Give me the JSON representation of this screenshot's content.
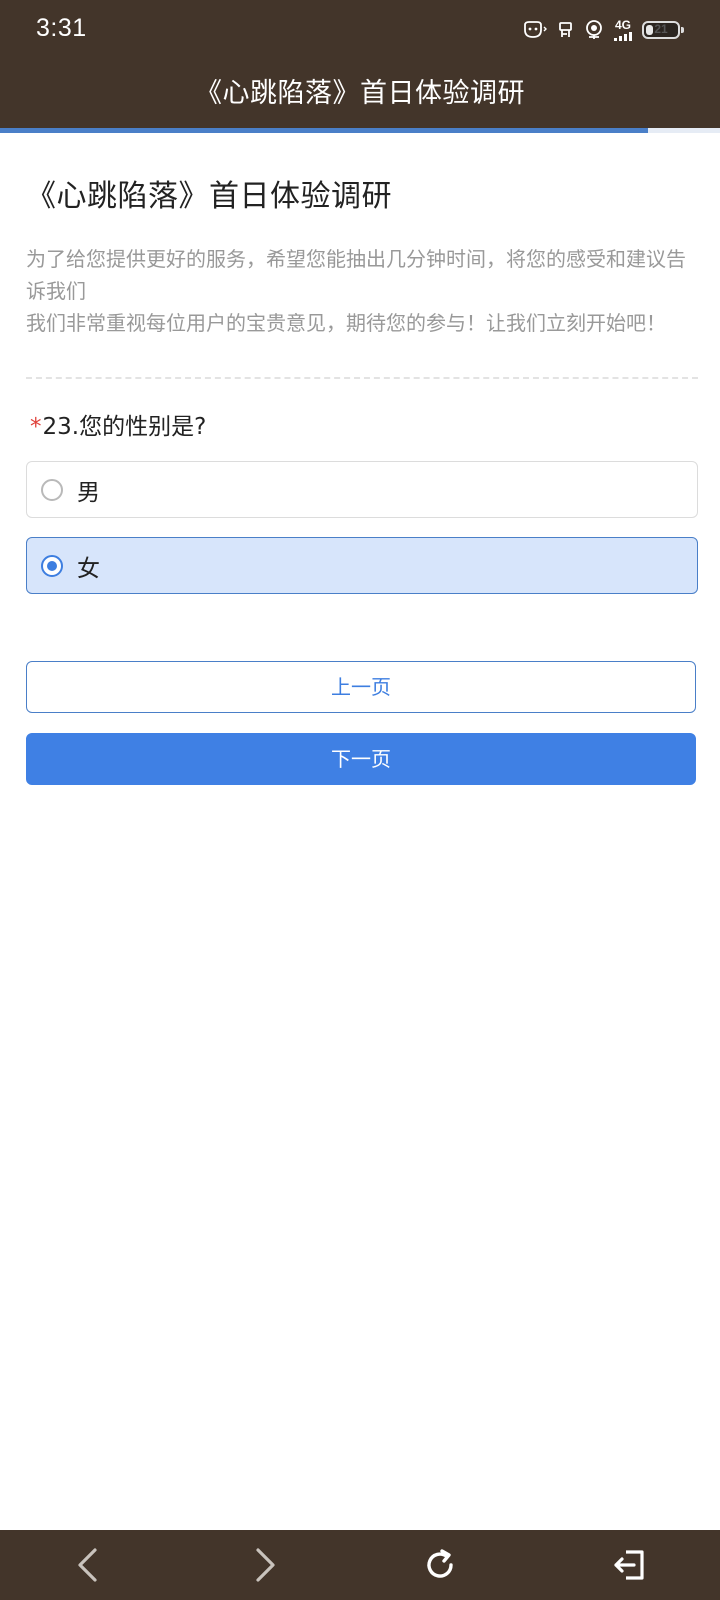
{
  "status_bar": {
    "time": "3:31",
    "network": "4G",
    "battery_level": "21",
    "icons": [
      "face-icon",
      "signal-extra-icon",
      "voice-assistant-icon",
      "cellular-signal-icon",
      "battery-icon"
    ]
  },
  "header": {
    "title": "《心跳陷落》首日体验调研",
    "progress": 0.9
  },
  "survey": {
    "title": "《心跳陷落》首日体验调研",
    "description_line1": "为了给您提供更好的服务，希望您能抽出几分钟时间，将您的感受和建议告诉我们",
    "description_line2": "我们非常重视每位用户的宝贵意见，期待您的参与！让我们立刻开始吧！"
  },
  "question": {
    "required_mark": "*",
    "text": "23.您的性别是?",
    "options": [
      {
        "label": "男",
        "selected": false
      },
      {
        "label": "女",
        "selected": true
      }
    ]
  },
  "buttons": {
    "prev": "上一页",
    "next": "下一页"
  },
  "bottom_nav": {
    "icons": [
      "back-arrow-icon",
      "forward-arrow-icon",
      "refresh-icon",
      "exit-icon"
    ]
  },
  "colors": {
    "bar_background": "#43352a",
    "accent": "#3f80e4",
    "selected_option_bg": "#d7e5fb",
    "required": "#e0413a"
  }
}
